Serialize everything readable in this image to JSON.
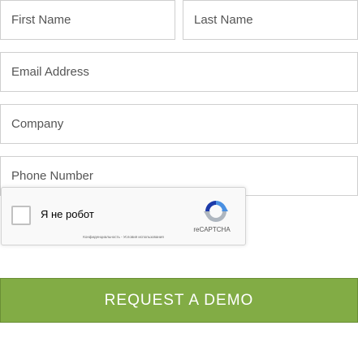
{
  "form": {
    "first_name_placeholder": "First Name",
    "last_name_placeholder": "Last Name",
    "email_placeholder": "Email Address",
    "company_placeholder": "Company",
    "phone_placeholder": "Phone Number"
  },
  "captcha": {
    "checkbox_label": "Я не робот",
    "brand": "reCAPTCHA",
    "terms": "Конфиденциальность - Условия использования",
    "logo_icon": "recaptcha-logo-icon"
  },
  "submit": {
    "label": "REQUEST A DEMO",
    "color": "#82ac45"
  }
}
